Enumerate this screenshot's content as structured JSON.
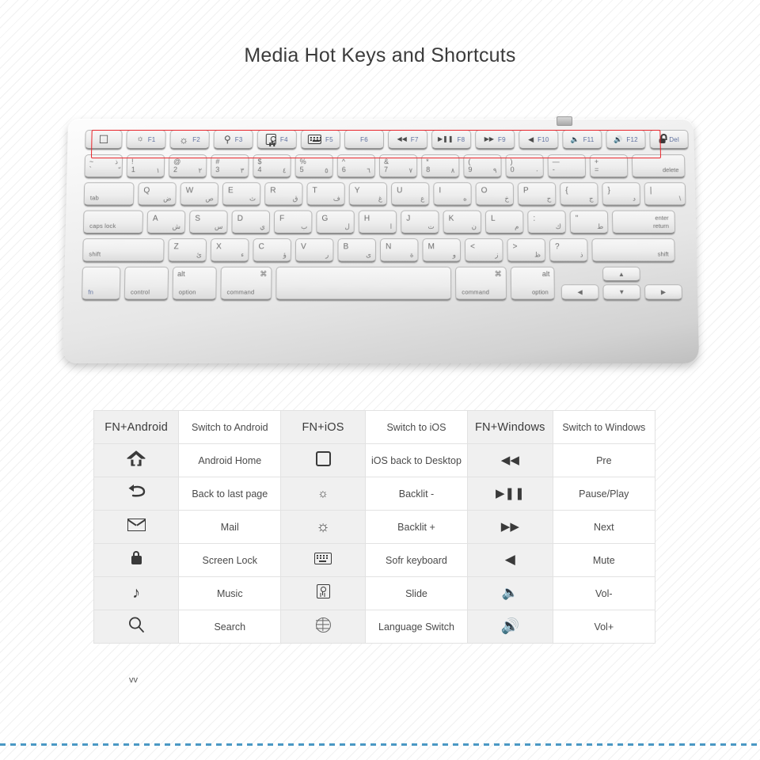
{
  "page": {
    "title": "Media Hot Keys and Shortcuts",
    "watermark": "vv",
    "accent_red": "#e8242a",
    "accent_blue": "#4a98c4",
    "fn_label_color": "#5d6f9e"
  },
  "keyboard": {
    "fn_row": [
      {
        "icon": "rounded-square-icon",
        "glyph": "▢",
        "label": ""
      },
      {
        "icon": "brightness-down-icon",
        "glyph": "☀",
        "label": "F1"
      },
      {
        "icon": "brightness-up-icon",
        "glyph": "☀",
        "label": "F2"
      },
      {
        "icon": "search-icon",
        "glyph": "⌕",
        "label": "F3"
      },
      {
        "icon": "slide-icon",
        "glyph": "",
        "label": "F4"
      },
      {
        "icon": "keyboard-icon",
        "glyph": "",
        "label": "F5"
      },
      {
        "icon": "",
        "glyph": "",
        "label": "F6"
      },
      {
        "icon": "rewind-icon",
        "glyph": "◀◀",
        "label": "F7"
      },
      {
        "icon": "play-pause-icon",
        "glyph": "▶‖",
        "label": "F8"
      },
      {
        "icon": "fast-forward-icon",
        "glyph": "▶▶",
        "label": "F9"
      },
      {
        "icon": "mute-icon",
        "glyph": "◀",
        "label": "F10"
      },
      {
        "icon": "volume-down-icon",
        "glyph": "◀)",
        "label": "F11"
      },
      {
        "icon": "volume-up-icon",
        "glyph": "◀))",
        "label": "F12"
      },
      {
        "icon": "lock-icon",
        "glyph": "ὑ2",
        "label": "Del"
      }
    ],
    "number_row": [
      {
        "top": "~",
        "bottom": "`",
        "ar_top": "ذ",
        "ar_bottom": "ّ"
      },
      {
        "top": "!",
        "bottom": "1",
        "ar_top": "",
        "ar_bottom": "١"
      },
      {
        "top": "@",
        "bottom": "2",
        "ar_top": "",
        "ar_bottom": "٢"
      },
      {
        "top": "#",
        "bottom": "3",
        "ar_top": "",
        "ar_bottom": "٣"
      },
      {
        "top": "$",
        "bottom": "4",
        "ar_top": "",
        "ar_bottom": "٤"
      },
      {
        "top": "%",
        "bottom": "5",
        "ar_top": "",
        "ar_bottom": "٥"
      },
      {
        "top": "^",
        "bottom": "6",
        "ar_top": "",
        "ar_bottom": "٦"
      },
      {
        "top": "&",
        "bottom": "7",
        "ar_top": "",
        "ar_bottom": "٧"
      },
      {
        "top": "*",
        "bottom": "8",
        "ar_top": "",
        "ar_bottom": "٨"
      },
      {
        "top": "(",
        "bottom": "9",
        "ar_top": "",
        "ar_bottom": "٩"
      },
      {
        "top": ")",
        "bottom": "0",
        "ar_top": "",
        "ar_bottom": "٠"
      },
      {
        "top": "—",
        "bottom": "-",
        "ar_top": "",
        "ar_bottom": ""
      },
      {
        "top": "+",
        "bottom": "=",
        "ar_top": "",
        "ar_bottom": ""
      },
      {
        "word": "delete"
      }
    ],
    "qwerty_row": [
      {
        "word": "tab"
      },
      {
        "lat": "Q",
        "ar": "ض"
      },
      {
        "lat": "W",
        "ar": "ص"
      },
      {
        "lat": "E",
        "ar": "ث"
      },
      {
        "lat": "R",
        "ar": "ق"
      },
      {
        "lat": "T",
        "ar": "ف"
      },
      {
        "lat": "Y",
        "ar": "غ"
      },
      {
        "lat": "U",
        "ar": "ع"
      },
      {
        "lat": "I",
        "ar": "ه"
      },
      {
        "lat": "O",
        "ar": "خ"
      },
      {
        "lat": "P",
        "ar": "ح"
      },
      {
        "lat": "{",
        "ar": "ج"
      },
      {
        "lat": "}",
        "ar": "د"
      },
      {
        "lat": "|",
        "ar": "\\"
      }
    ],
    "home_row": [
      {
        "word": "caps lock"
      },
      {
        "lat": "A",
        "ar": "ش"
      },
      {
        "lat": "S",
        "ar": "س"
      },
      {
        "lat": "D",
        "ar": "ي"
      },
      {
        "lat": "F",
        "ar": "ب"
      },
      {
        "lat": "G",
        "ar": "ل"
      },
      {
        "lat": "H",
        "ar": "ا"
      },
      {
        "lat": "J",
        "ar": "ت"
      },
      {
        "lat": "K",
        "ar": "ن"
      },
      {
        "lat": "L",
        "ar": "م"
      },
      {
        "lat": ":",
        "ar": "ك"
      },
      {
        "lat": "\"",
        "ar": "ط"
      },
      {
        "word_tr": "enter",
        "word_br": "return"
      }
    ],
    "shift_row": [
      {
        "word": "shift"
      },
      {
        "lat": "Z",
        "ar": "ئ"
      },
      {
        "lat": "X",
        "ar": "ء"
      },
      {
        "lat": "C",
        "ar": "ؤ"
      },
      {
        "lat": "V",
        "ar": "ر"
      },
      {
        "lat": "B",
        "ar": "ى"
      },
      {
        "lat": "N",
        "ar": "ة"
      },
      {
        "lat": "M",
        "ar": "و"
      },
      {
        "lat": "<",
        "ar": "ز"
      },
      {
        "lat": ">",
        "ar": "ظ"
      },
      {
        "lat": "?",
        "ar": "ذ"
      },
      {
        "word_r": "shift"
      }
    ],
    "bottom_row": [
      {
        "word": "fn",
        "blue": true
      },
      {
        "word": "control"
      },
      {
        "top": "alt",
        "word": "option"
      },
      {
        "top": "⌘",
        "word": "command"
      },
      {
        "space": true
      },
      {
        "top": "⌘",
        "word": "command"
      },
      {
        "top": "alt",
        "word": "option"
      }
    ],
    "arrows": {
      "left": "◀",
      "up": "▲",
      "down": "▼",
      "right": "▶"
    }
  },
  "table": {
    "columns": [
      {
        "header_icon": "FN+Android",
        "header_label": "Switch to Android",
        "rows": [
          {
            "icon": "home-arrow-icon",
            "label": "Android Home"
          },
          {
            "icon": "back-arrow-icon",
            "label": "Back to last page"
          },
          {
            "icon": "mail-icon",
            "label": "Mail"
          },
          {
            "icon": "lock-icon",
            "label": "Screen Lock"
          },
          {
            "icon": "music-note-icon",
            "label": "Music"
          },
          {
            "icon": "search-icon",
            "label": "Search"
          }
        ]
      },
      {
        "header_icon": "FN+iOS",
        "header_label": "Switch to iOS",
        "rows": [
          {
            "icon": "rounded-square-icon",
            "label": "iOS back to Desktop"
          },
          {
            "icon": "brightness-down-icon",
            "label": "Backlit -"
          },
          {
            "icon": "brightness-up-icon",
            "label": "Backlit +"
          },
          {
            "icon": "keyboard-icon",
            "label": "Sofr keyboard"
          },
          {
            "icon": "slide-icon",
            "label": "Slide"
          },
          {
            "icon": "globe-icon",
            "label": "Language Switch"
          }
        ]
      },
      {
        "header_icon": "FN+Windows",
        "header_label": "Switch to Windows",
        "rows": [
          {
            "icon": "rewind-icon",
            "label": "Pre"
          },
          {
            "icon": "play-pause-icon",
            "label": "Pause/Play"
          },
          {
            "icon": "fast-forward-icon",
            "label": "Next"
          },
          {
            "icon": "mute-icon",
            "label": "Mute"
          },
          {
            "icon": "volume-down-icon",
            "label": "Vol-"
          },
          {
            "icon": "volume-up-icon",
            "label": "Vol+"
          }
        ]
      }
    ]
  }
}
